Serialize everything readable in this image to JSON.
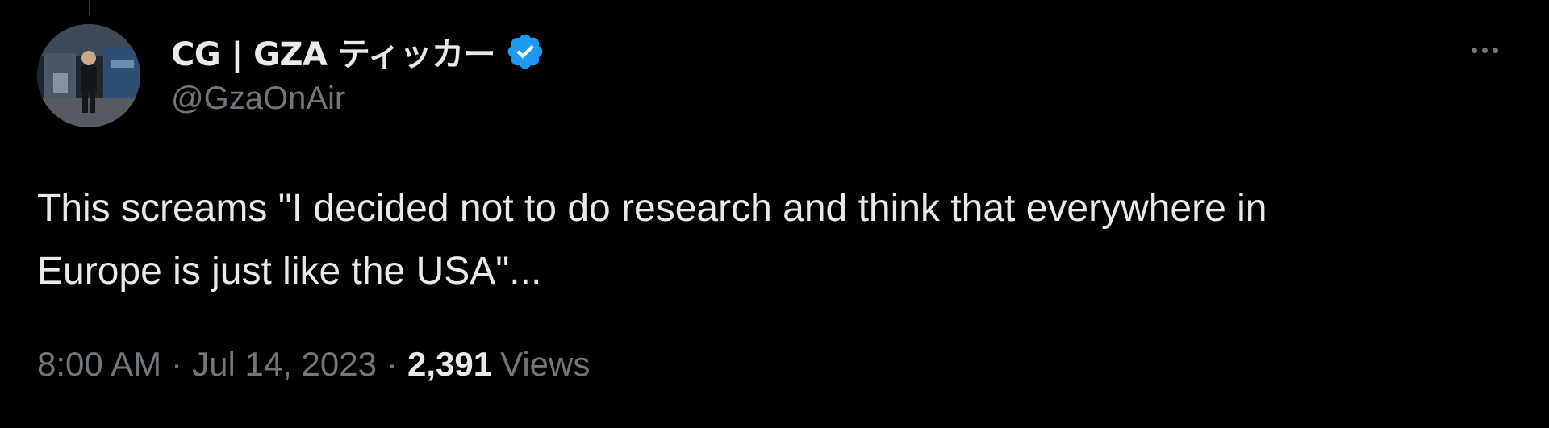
{
  "author": {
    "display_name": "CG | GZA ティッカー",
    "handle": "@GzaOnAir",
    "verified_icon": "verified-badge-icon",
    "avatar_icon": "avatar-photo"
  },
  "tweet": {
    "line1": "This screams \"I decided not to do research and think that everywhere in",
    "line2": "Europe is just like the USA\"..."
  },
  "meta": {
    "time": "8:00 AM",
    "separator": "·",
    "date": "Jul 14, 2023",
    "views_count": "2,391",
    "views_label": "Views"
  },
  "actions": {
    "more_icon": "more-horizontal-icon"
  },
  "colors": {
    "background": "#000000",
    "primary_text": "#e7e9ea",
    "secondary_text": "#71767b",
    "verified_blue": "#1d9bf0"
  }
}
